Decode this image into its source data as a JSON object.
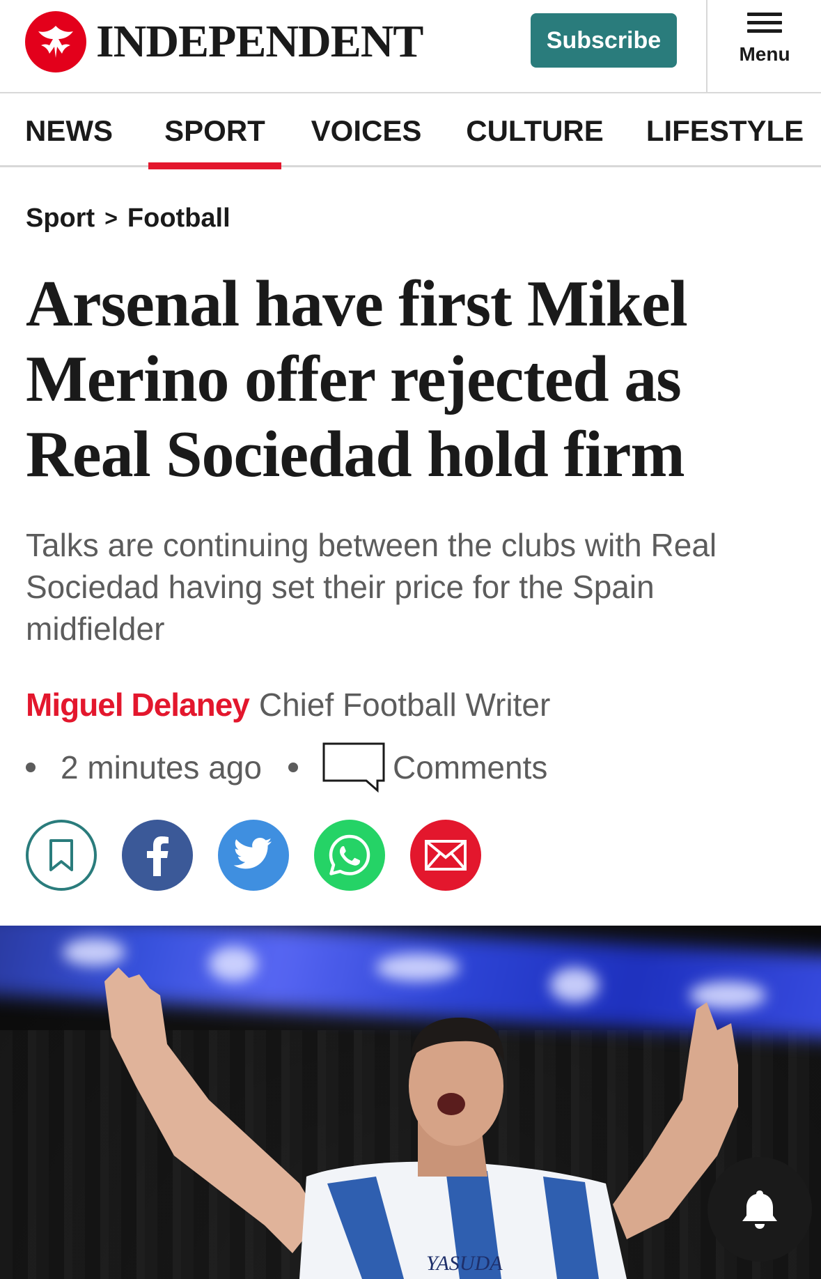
{
  "header": {
    "brand": "INDEPENDENT",
    "subscribe_label": "Subscribe",
    "menu_label": "Menu"
  },
  "nav": {
    "items": [
      {
        "label": "NEWS"
      },
      {
        "label": "SPORT",
        "active": true
      },
      {
        "label": "VOICES"
      },
      {
        "label": "CULTURE"
      },
      {
        "label": "LIFESTYLE"
      }
    ]
  },
  "breadcrumb": {
    "section": "Sport",
    "separator": ">",
    "subsection": "Football"
  },
  "article": {
    "headline": "Arsenal have first Mikel Merino offer rejected as Real Sociedad hold firm",
    "standfirst": "Talks are continuing between the clubs with Real Sociedad having set their price for the Spain midfielder",
    "author": "Miguel Delaney",
    "author_role": "Chief Football Writer",
    "published": "2 minutes ago",
    "comments_label": "Comments"
  },
  "share": {
    "icons": [
      "bookmark-icon",
      "facebook-icon",
      "twitter-icon",
      "whatsapp-icon",
      "email-icon"
    ]
  },
  "colors": {
    "brand_red": "#e3172d",
    "subscribe_teal": "#2a7c7c",
    "facebook": "#3b5998",
    "twitter": "#3f8fe0",
    "whatsapp": "#25d366"
  }
}
